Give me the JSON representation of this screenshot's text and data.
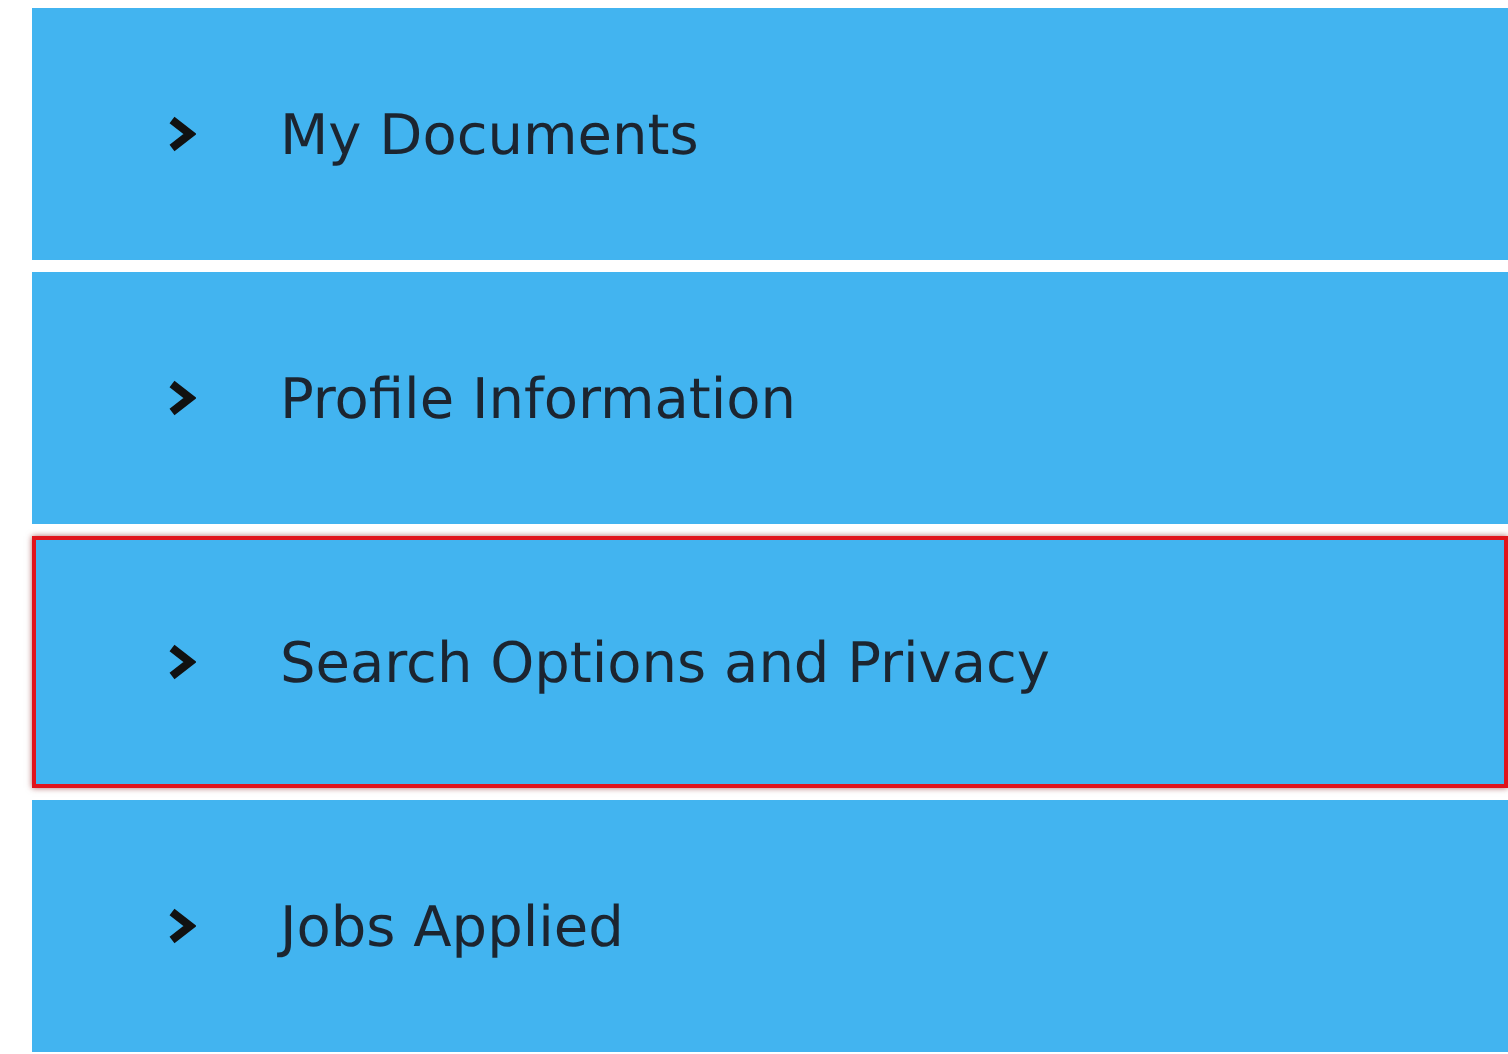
{
  "sections": [
    {
      "label": "My Documents",
      "expanded": false,
      "highlighted": false
    },
    {
      "label": "Profile Information",
      "expanded": false,
      "highlighted": false
    },
    {
      "label": "Search Options and Privacy",
      "expanded": false,
      "highlighted": true
    },
    {
      "label": "Jobs Applied",
      "expanded": false,
      "highlighted": false
    }
  ]
}
